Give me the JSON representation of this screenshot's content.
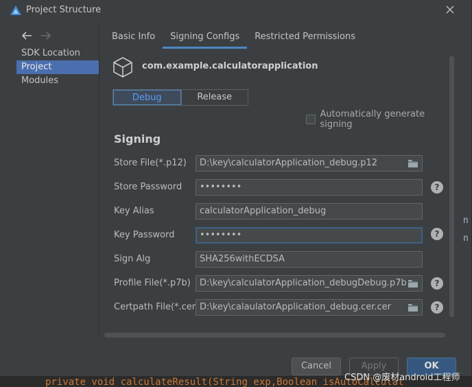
{
  "window": {
    "title": "Project Structure"
  },
  "sidebar": {
    "items": [
      {
        "label": "SDK Location",
        "selected": false
      },
      {
        "label": "Project",
        "selected": true
      },
      {
        "label": "Modules",
        "selected": false
      }
    ]
  },
  "tabs": [
    {
      "label": "Basic Info",
      "active": false
    },
    {
      "label": "Signing Configs",
      "active": true
    },
    {
      "label": "Restricted Permissions",
      "active": false
    }
  ],
  "module": {
    "name": "com.example.calculatorapplication"
  },
  "build_types": {
    "debug": "Debug",
    "release": "Release",
    "selected": "Debug"
  },
  "auto_generate": {
    "label": "Automatically generate signing",
    "checked": false
  },
  "signing": {
    "title": "Signing",
    "fields": [
      {
        "label": "Store File(*.p12)",
        "value": "D:\\key\\calculatorApplication_debug.p12",
        "browse": true,
        "help": false
      },
      {
        "label": "Store Password",
        "value": "••••••••",
        "browse": false,
        "help": true
      },
      {
        "label": "Key Alias",
        "value": "calculatorApplication_debug",
        "browse": false,
        "help": false
      },
      {
        "label": "Key Password",
        "value": "••••••••",
        "browse": false,
        "help": true,
        "focused": true
      },
      {
        "label": "Sign Alg",
        "value": "SHA256withECDSA",
        "browse": false,
        "help": false
      },
      {
        "label": "Profile File(*.p7b)",
        "value": "D:\\key\\calculatorApplication_debugDebug.p7b",
        "browse": true,
        "help": true
      },
      {
        "label": "Certpath File(*.cer)",
        "value": "D:\\key\\calaulatorApplication_debug.cer.cer",
        "browse": true,
        "help": true
      }
    ]
  },
  "buttons": {
    "cancel": "Cancel",
    "apply": "Apply",
    "ok": "OK"
  },
  "help_glyph": "?",
  "background_editor": {
    "code": "private void calculateResult(String exp,Boolean isAutoCalculat",
    "right_chars": [
      "n",
      "n"
    ]
  },
  "watermark": "CSDN @废材android工程师",
  "colors": {
    "accent": "#4a88c7",
    "selection": "#4b6eaf",
    "ok_button": "#365880"
  }
}
